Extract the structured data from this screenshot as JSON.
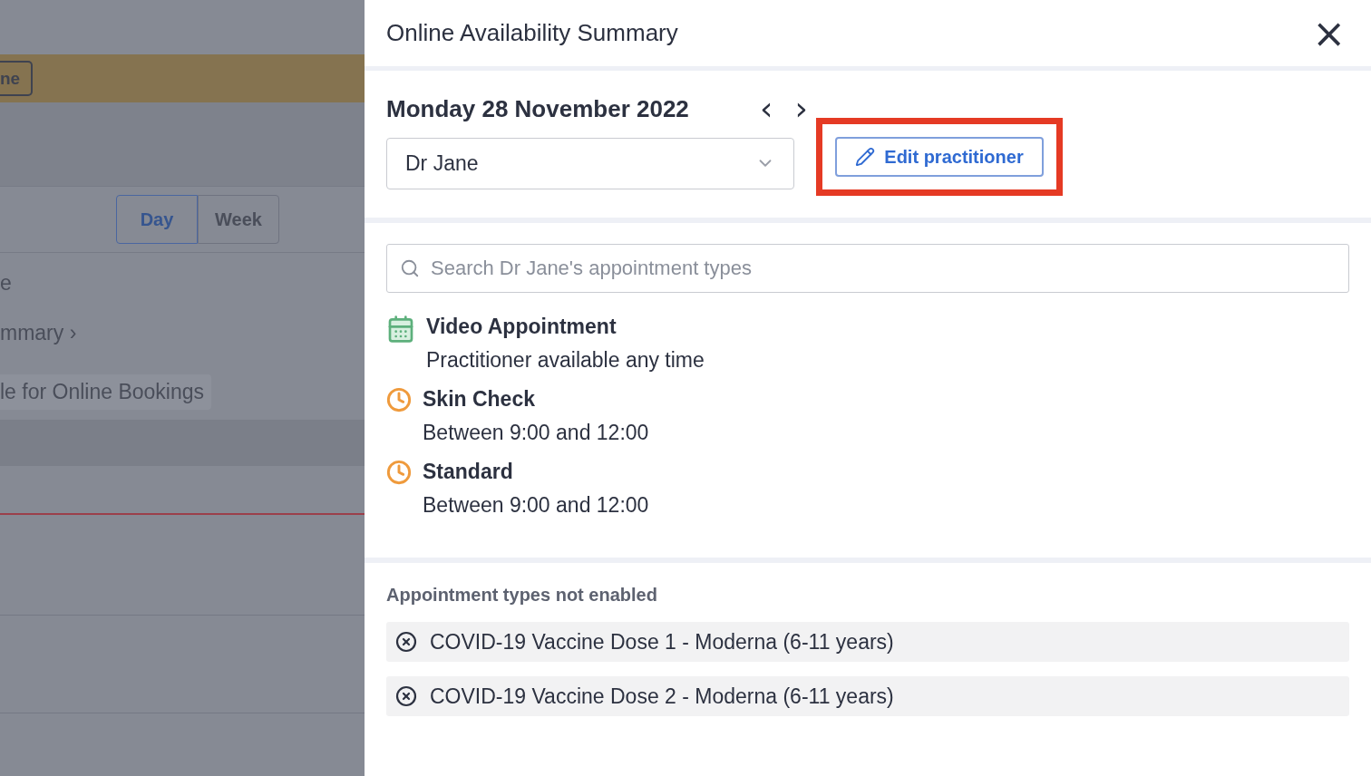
{
  "background": {
    "banner_button": "ne",
    "view_tabs": [
      {
        "label": "Day",
        "selected": true
      },
      {
        "label": "Week",
        "selected": false
      }
    ],
    "lines": [
      {
        "kind": "text",
        "label": "e"
      },
      {
        "kind": "link",
        "label": "mmary ›"
      },
      {
        "kind": "pill",
        "label": "le for Online Bookings"
      }
    ]
  },
  "panel": {
    "title": "Online Availability Summary",
    "close": "×",
    "date": "Monday 28 November 2022",
    "prev": "‹",
    "next": "›",
    "practitioner_select": {
      "value": "Dr Jane"
    },
    "edit_button": {
      "label": "Edit practitioner",
      "highlighted": true
    },
    "search": {
      "placeholder": "Search Dr Jane's appointment types"
    },
    "appointment_types": [
      {
        "kind": "calendar",
        "name": "Video Appointment",
        "detail": "Practitioner available any time"
      },
      {
        "kind": "clock",
        "name": "Skin Check",
        "detail": "Between 9:00 and 12:00"
      },
      {
        "kind": "clock",
        "name": "Standard",
        "detail": "Between 9:00 and 12:00"
      }
    ],
    "not_enabled": {
      "heading": "Appointment types not enabled",
      "items": [
        {
          "name": "COVID-19 Vaccine Dose 1 - Moderna (6-11 years)"
        },
        {
          "name": "COVID-19 Vaccine Dose 2 - Moderna (6-11 years)"
        }
      ]
    }
  }
}
